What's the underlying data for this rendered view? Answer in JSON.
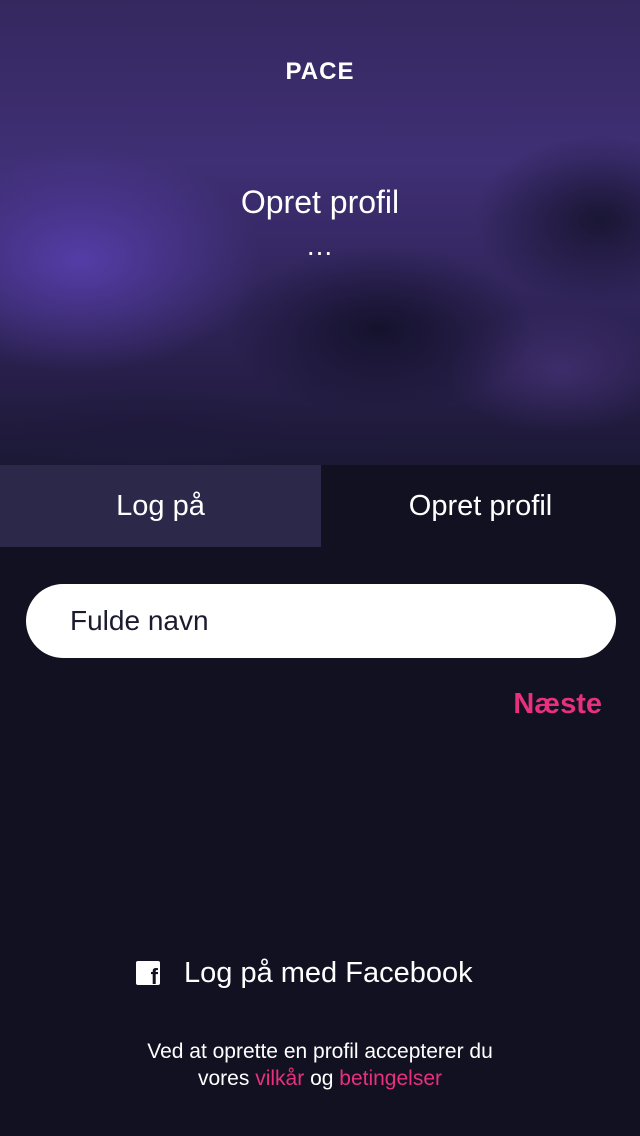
{
  "hero": {
    "brand": "PACE",
    "title": "Opret profil",
    "dots": "..."
  },
  "tabs": {
    "login": "Log på",
    "signup": "Opret profil",
    "active": "signup"
  },
  "form": {
    "name_placeholder": "Fulde navn",
    "name_value": "",
    "next_label": "Næste"
  },
  "facebook": {
    "icon": "facebook-icon",
    "label": "Log på med Facebook"
  },
  "terms": {
    "line1": "Ved at oprette en profil accepterer du",
    "prefix": "vores",
    "link1": "vilkår",
    "middle": "og",
    "link2": "betingelser"
  },
  "colors": {
    "background": "#121121",
    "accent": "#e8307c",
    "inactive_tab": "#2b284a"
  }
}
